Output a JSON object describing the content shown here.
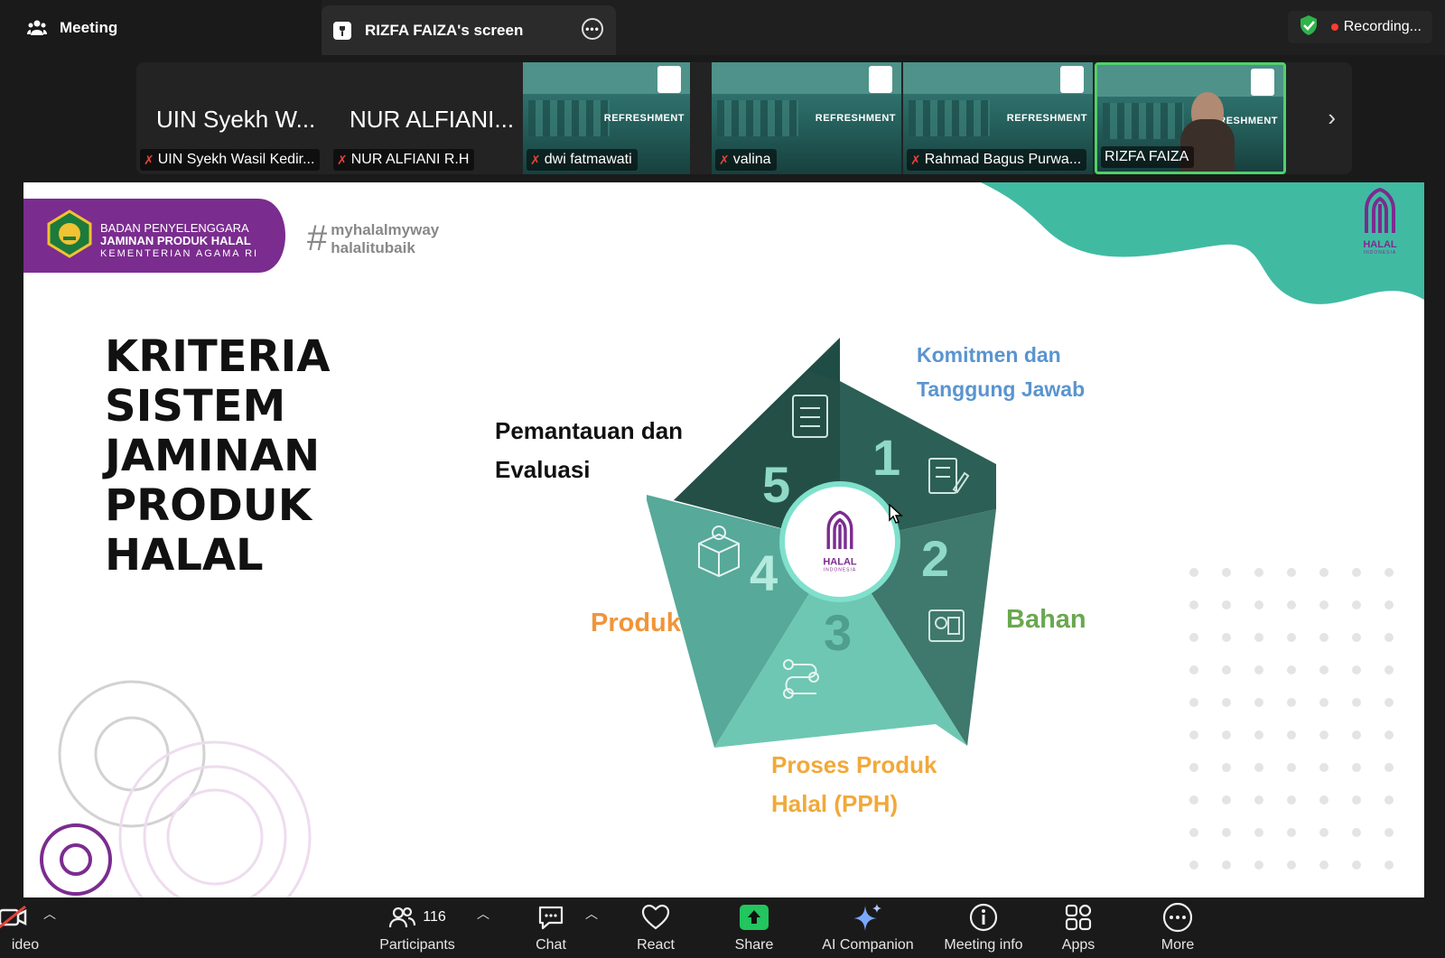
{
  "topbar": {
    "meeting_tab": "Meeting",
    "screen_tab": "RIZFA FAIZA's screen",
    "recording": "Recording..."
  },
  "participants_strip": [
    {
      "big": "UIN Syekh W...",
      "name": "UIN Syekh Wasil Kedir...",
      "muted": true,
      "video": false
    },
    {
      "big": "NUR ALFIANI...",
      "name": "NUR ALFIANI R.H",
      "muted": true,
      "video": false
    },
    {
      "big": "",
      "name": "dwi fatmawati",
      "muted": true,
      "video": true
    },
    {
      "big": "",
      "name": "valina",
      "muted": true,
      "video": true
    },
    {
      "big": "",
      "name": "Rahmad Bagus Purwa...",
      "muted": true,
      "video": true
    },
    {
      "big": "",
      "name": "RIZFA FAIZA",
      "muted": false,
      "video": true,
      "active": true
    }
  ],
  "thumb_text": "REFRESHMENT",
  "slide": {
    "org_line1": "BADAN PENYELENGGARA",
    "org_line2": "JAMINAN PRODUK HALAL",
    "org_line3": "KEMENTERIAN AGAMA RI",
    "hashtag_symbol": "#",
    "hashtag1": "myhalalmyway",
    "hashtag2": "halalitubaik",
    "halal_logo_text": "HALAL",
    "halal_logo_sub": "INDONESIA",
    "title_lines": [
      "KRITERIA",
      "SISTEM",
      "JAMINAN",
      "PRODUK",
      "HALAL"
    ],
    "labels": {
      "l1a": "Komitmen dan",
      "l1b": "Tanggung Jawab",
      "l2": "Bahan",
      "l3a": "Proses Produk",
      "l3b": "Halal (PPH)",
      "l4": "Produk",
      "l5a": "Pemantauan dan",
      "l5b": "Evaluasi"
    },
    "numbers": [
      "1",
      "2",
      "3",
      "4",
      "5"
    ],
    "center_text": "HALAL",
    "center_sub": "INDONESIA",
    "colors": {
      "teal": "#3fbfa4",
      "purple": "#7b2c8f",
      "blue": "#5a94cf",
      "green": "#6aa84f",
      "orange": "#f0953a",
      "gold": "#f1a93a"
    }
  },
  "bottombar": {
    "video": "ideo",
    "participants": "Participants",
    "participants_count": "116",
    "chat": "Chat",
    "react": "React",
    "share": "Share",
    "ai": "AI Companion",
    "info": "Meeting info",
    "apps": "Apps",
    "more": "More"
  }
}
